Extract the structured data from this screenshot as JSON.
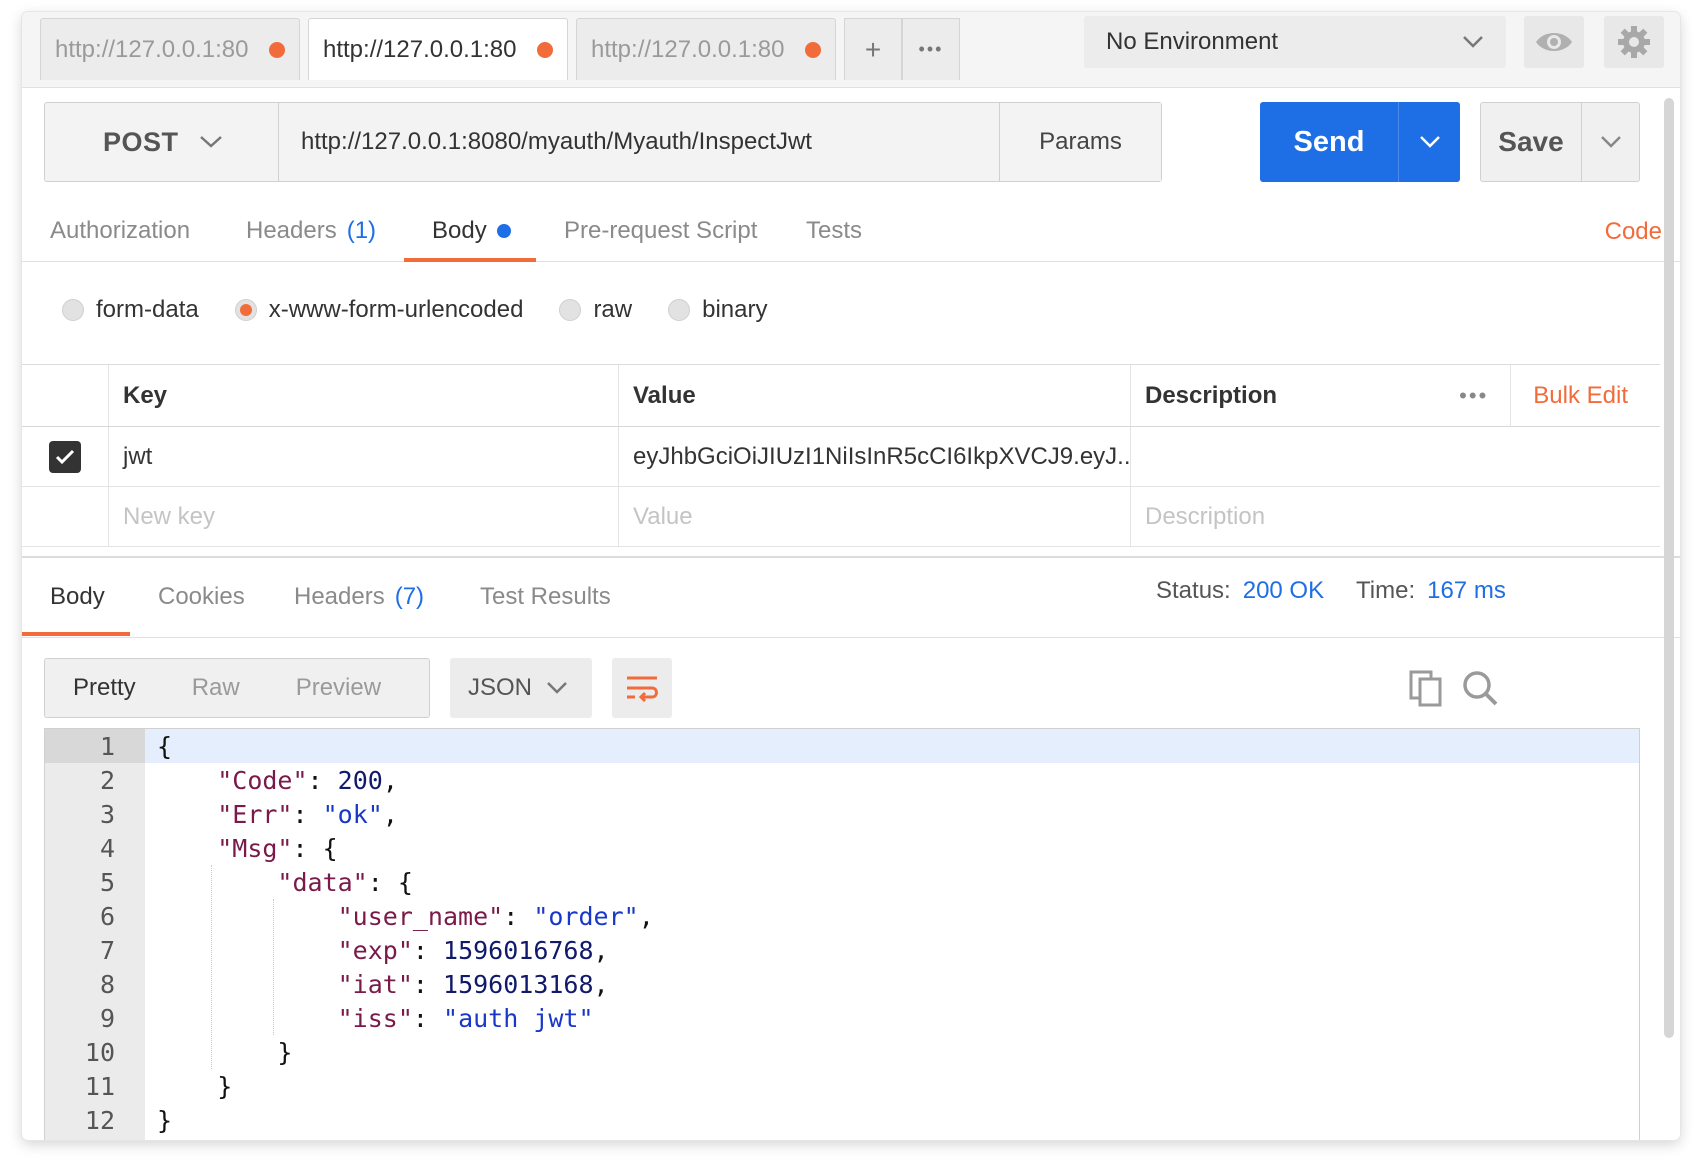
{
  "colors": {
    "accent": "#f26b3a",
    "primary": "#1e6fe5"
  },
  "tabs": [
    {
      "label": "http://127.0.0.1:80",
      "active": false
    },
    {
      "label": "http://127.0.0.1:80",
      "active": true
    },
    {
      "label": "http://127.0.0.1:80",
      "active": false
    }
  ],
  "tabbar": {
    "new_tab": "+",
    "more": "•••"
  },
  "environment": {
    "selected": "No Environment"
  },
  "request": {
    "method": "POST",
    "url": "http://127.0.0.1:8080/myauth/Myauth/InspectJwt",
    "params_label": "Params",
    "send_label": "Send",
    "save_label": "Save"
  },
  "request_tabs": {
    "authorization": "Authorization",
    "headers": "Headers",
    "headers_count": "(1)",
    "body": "Body",
    "prerequest": "Pre-request Script",
    "tests": "Tests",
    "code": "Code"
  },
  "body_types": {
    "form_data": "form-data",
    "urlencoded": "x-www-form-urlencoded",
    "raw": "raw",
    "binary": "binary",
    "selected": "x-www-form-urlencoded"
  },
  "params_table": {
    "headers": {
      "key": "Key",
      "value": "Value",
      "description": "Description"
    },
    "more": "•••",
    "bulk_edit": "Bulk Edit",
    "rows": [
      {
        "checked": true,
        "key": "jwt",
        "value": "eyJhbGciOiJIUzI1NiIsInR5cCI6IkpXVCJ9.eyJ...",
        "description": ""
      }
    ],
    "placeholders": {
      "key": "New key",
      "value": "Value",
      "description": "Description"
    }
  },
  "response_tabs": {
    "body": "Body",
    "cookies": "Cookies",
    "headers": "Headers",
    "headers_count": "(7)",
    "test_results": "Test Results"
  },
  "response_meta": {
    "status_label": "Status:",
    "status_value": "200 OK",
    "time_label": "Time:",
    "time_value": "167 ms"
  },
  "response_view": {
    "pretty": "Pretty",
    "raw": "Raw",
    "preview": "Preview",
    "format": "JSON"
  },
  "response_body": [
    {
      "n": "1",
      "fold": true,
      "text": "{"
    },
    {
      "n": "2",
      "fold": false,
      "text": "    \"Code\": 200,"
    },
    {
      "n": "3",
      "fold": false,
      "text": "    \"Err\": \"ok\","
    },
    {
      "n": "4",
      "fold": true,
      "text": "    \"Msg\": {"
    },
    {
      "n": "5",
      "fold": true,
      "text": "        \"data\": {"
    },
    {
      "n": "6",
      "fold": false,
      "text": "            \"user_name\": \"order\","
    },
    {
      "n": "7",
      "fold": false,
      "text": "            \"exp\": 1596016768,"
    },
    {
      "n": "8",
      "fold": false,
      "text": "            \"iat\": 1596013168,"
    },
    {
      "n": "9",
      "fold": false,
      "text": "            \"iss\": \"auth jwt\""
    },
    {
      "n": "10",
      "fold": false,
      "text": "        }"
    },
    {
      "n": "11",
      "fold": false,
      "text": "    }"
    },
    {
      "n": "12",
      "fold": false,
      "text": "}"
    }
  ]
}
